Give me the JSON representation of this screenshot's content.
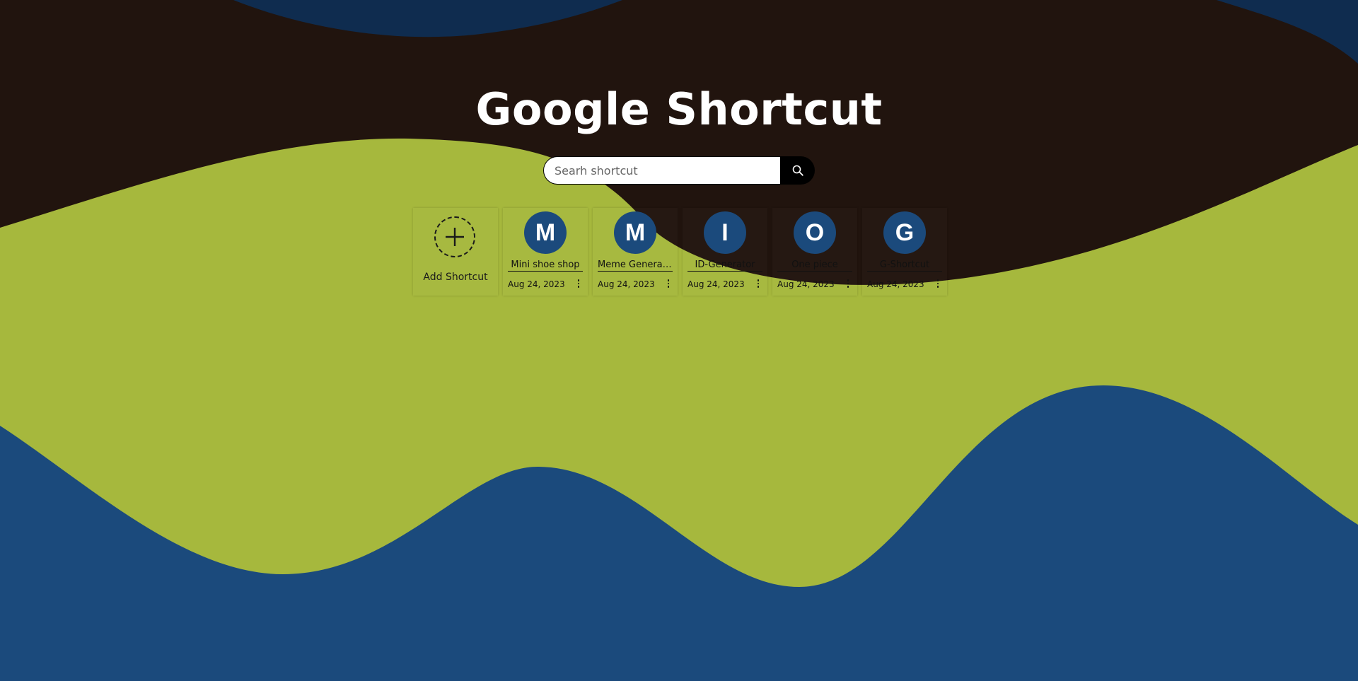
{
  "title": "Google Shortcut",
  "search": {
    "placeholder": "Searh shortcut"
  },
  "add_label": "Add Shortcut",
  "shortcuts": [
    {
      "letter": "M",
      "name": "Mini shoe shop",
      "date": "Aug 24, 2023"
    },
    {
      "letter": "M",
      "name": "Meme Generator",
      "date": "Aug 24, 2023"
    },
    {
      "letter": "I",
      "name": "ID-Generator",
      "date": "Aug 24, 2023"
    },
    {
      "letter": "O",
      "name": "One piece",
      "date": "Aug 24, 2023"
    },
    {
      "letter": "G",
      "name": "G-Shortcut",
      "date": "Aug 24, 2023"
    }
  ],
  "colors": {
    "background_lime": "#a6b83d",
    "background_dark": "#21140e",
    "background_blue": "#1b4a7c",
    "avatar": "#1b4a7c"
  },
  "icons": {
    "search": "search-icon",
    "add": "plus-icon",
    "menu": "kebab-menu-icon"
  }
}
